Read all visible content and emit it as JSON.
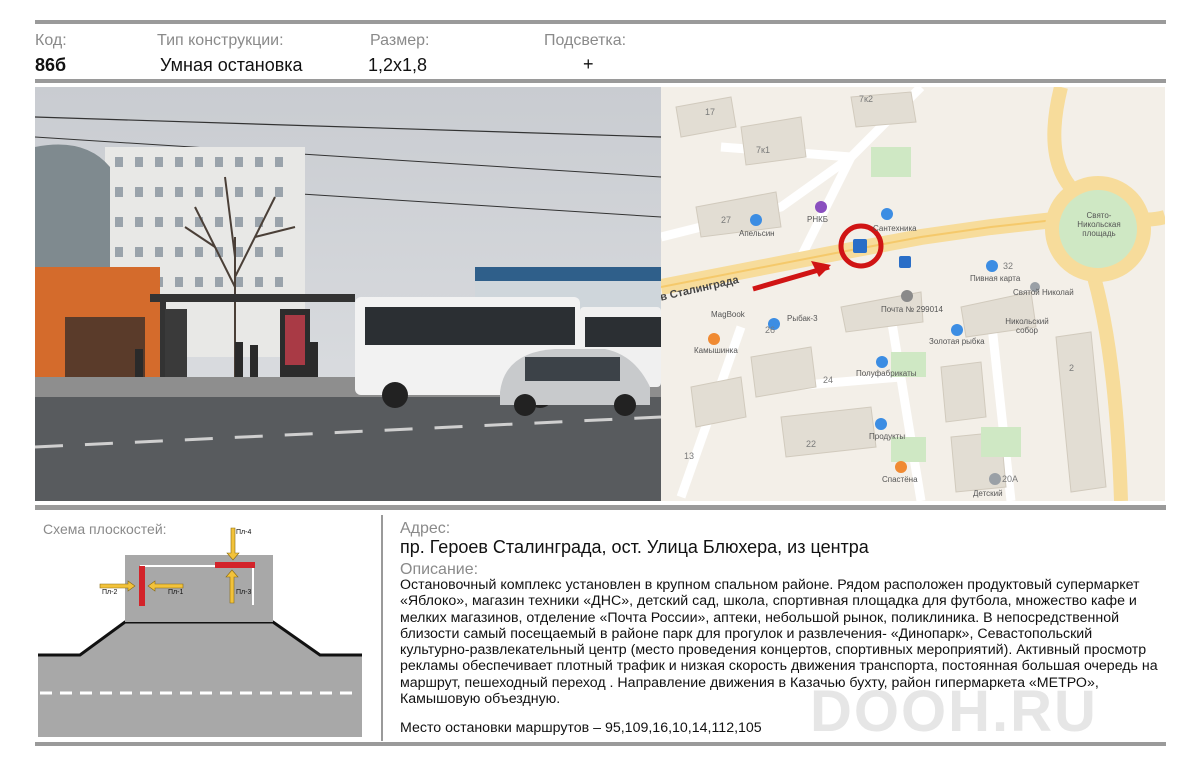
{
  "header": {
    "code_label": "Код:",
    "code_value": "86б",
    "type_label": "Тип конструкции:",
    "type_value": "Умная остановка",
    "size_label": "Размер:",
    "size_value": "1,2x1,8",
    "light_label": "Подсветка:",
    "light_value": "+"
  },
  "map": {
    "street": "в Сталинграда",
    "place_sv_nik": "Свято-Никольская площадь",
    "labels": {
      "n17": "17",
      "n7x2": "7к2",
      "n7x1": "7к1",
      "n27": "27",
      "n26": "26",
      "n24": "24",
      "n22": "22",
      "n13": "13",
      "n32": "32",
      "n2": "2",
      "n20a": "20А",
      "rnkb": "РНКБ",
      "santeh": "Сантехника",
      "apelsin": "Апельсин",
      "magbook": "MagBook",
      "rybak": "Рыбак-3",
      "kamysh": "Камышинка",
      "pochta": "Почта № 299014",
      "zolotaya": "Золотая рыбка",
      "polufab": "Полуфабрикаты",
      "produkty": "Продукты",
      "spastena": "Спастёна",
      "detsky": "Детский",
      "pivnaya": "Пивная карта",
      "sv_nikolay": "Святой Николай",
      "nikolsky": "Никольский собор"
    }
  },
  "scheme": {
    "title": "Схема плоскостей:",
    "pl1": "Пл-1",
    "pl2": "Пл-2",
    "pl3": "Пл-3",
    "pl4": "Пл-4"
  },
  "info": {
    "address_label": "Адрес:",
    "address": "пр. Героев Сталинграда, ост. Улица Блюхера, из центра",
    "desc_label": "Описание:",
    "description": "Остановочный комплекс установлен в крупном спальном районе. Рядом расположен продуктовый супермаркет «Яблоко», магазин техники «ДНС», детский сад, школа, спортивная  площадка для футбола, множество кафе и мелких магазинов, отделение «Почта России», аптеки, небольшой рынок, поликлиника. В непосредственной близости самый посещаемый в районе парк для прогулок и развлечения- «Динопарк», Севастопольский культурно-развлекательный центр (место проведения концертов, спортивных мероприятий). Активный просмотр рекламы обеспечивает плотный трафик и низкая скорость движения транспорта, постоянная большая очередь на маршрут, пешеходный переход . Направление движения в Казачью бухту, район гипермаркета «МЕТРО», Камышовую объездную.",
    "routes": "Место остановки маршрутов – 95,109,16,10,14,112,105"
  },
  "watermark": "DOOH.RU"
}
